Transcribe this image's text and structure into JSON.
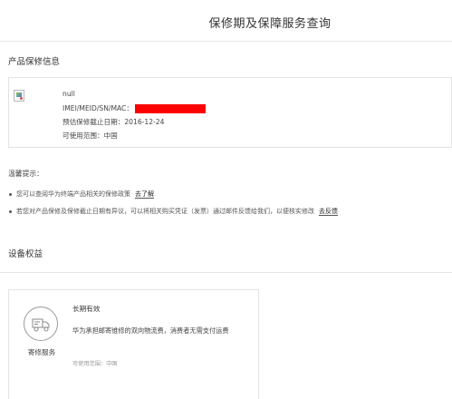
{
  "header": {
    "title": "保修期及保障服务查询"
  },
  "product_section": {
    "heading": "产品保修信息",
    "name": "null",
    "id_label": "IMEI/MEID/SN/MAC：",
    "warranty_date_line": "预估保修截止日期：2016-12-24",
    "region_line": "可使用范围：中国"
  },
  "tips": {
    "title": "温馨提示：",
    "items": [
      {
        "text": "您可以查阅华为终端产品相关的保修政策",
        "link": "去了解"
      },
      {
        "text": "若您对产品保修及保修截止日期有异议，可以将相关购买凭证（发票）通过邮件反馈给我们，以便核实修改",
        "link": "去反馈"
      }
    ]
  },
  "benefits": {
    "heading": "设备权益",
    "card": {
      "icon": "delivery-truck-icon",
      "label": "寄修服务",
      "validity": "长期有效",
      "description": "华为承担邮寄维修的双向物流费，消费者无需支付运费",
      "scope": "可使用范围：中国"
    }
  }
}
